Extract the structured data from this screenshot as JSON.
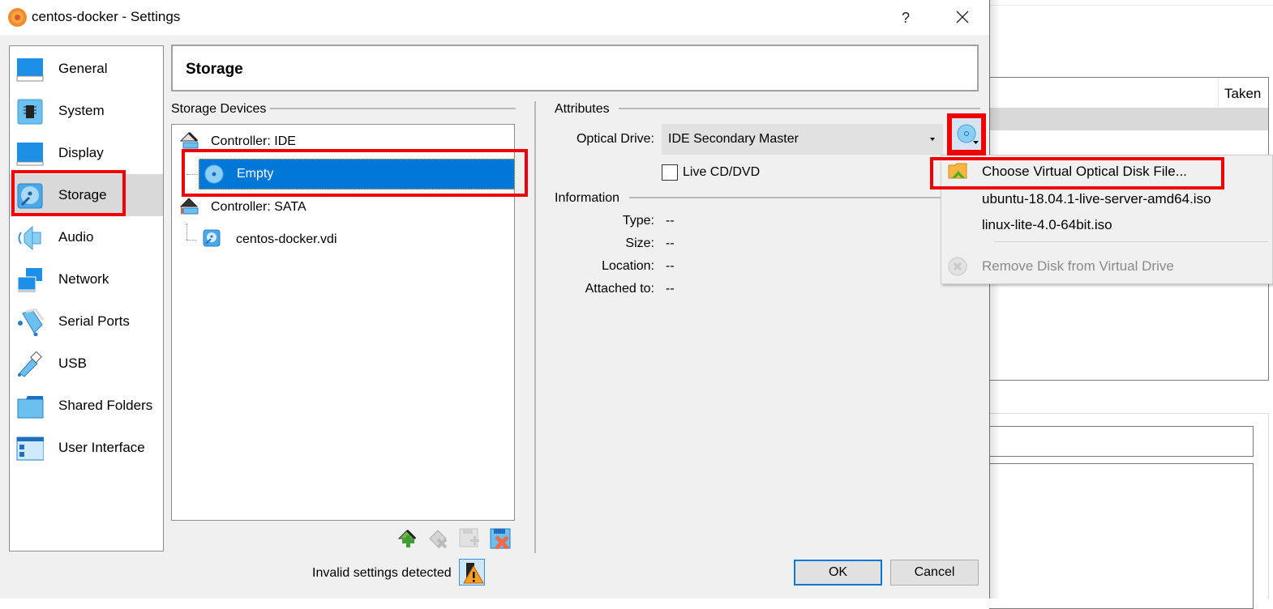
{
  "window": {
    "title": "centos-docker - Settings",
    "help_label": "?",
    "icons": {
      "app": "virtualbox-settings-icon",
      "close": "close-icon"
    }
  },
  "sidebar": {
    "items": [
      {
        "label": "General",
        "icon": "general-monitor-icon",
        "selected": false
      },
      {
        "label": "System",
        "icon": "system-chip-icon",
        "selected": false
      },
      {
        "label": "Display",
        "icon": "display-monitor-icon",
        "selected": false
      },
      {
        "label": "Storage",
        "icon": "storage-disk-icon",
        "selected": true
      },
      {
        "label": "Audio",
        "icon": "audio-speaker-icon",
        "selected": false
      },
      {
        "label": "Network",
        "icon": "network-icon",
        "selected": false
      },
      {
        "label": "Serial Ports",
        "icon": "serial-port-icon",
        "selected": false
      },
      {
        "label": "USB",
        "icon": "usb-icon",
        "selected": false
      },
      {
        "label": "Shared Folders",
        "icon": "folder-icon",
        "selected": false
      },
      {
        "label": "User Interface",
        "icon": "user-interface-icon",
        "selected": false
      }
    ]
  },
  "page": {
    "title": "Storage"
  },
  "storage_devices": {
    "group_title": "Storage Devices",
    "tree": [
      {
        "label": "Controller: IDE",
        "type": "controller",
        "icon": "ide-controller-icon"
      },
      {
        "label": "Empty",
        "type": "optical",
        "icon": "optical-disc-icon",
        "selected": true
      },
      {
        "label": "Controller: SATA",
        "type": "controller",
        "icon": "sata-controller-icon"
      },
      {
        "label": "centos-docker.vdi",
        "type": "hdd",
        "icon": "hard-disk-icon"
      }
    ],
    "toolbar": [
      {
        "name": "add-controller",
        "icon": "add-controller-icon",
        "enabled": true
      },
      {
        "name": "remove-controller",
        "icon": "remove-controller-icon",
        "enabled": false
      },
      {
        "name": "add-attachment",
        "icon": "add-attachment-icon",
        "enabled": false
      },
      {
        "name": "remove-attachment",
        "icon": "remove-attachment-icon",
        "enabled": true
      }
    ]
  },
  "attributes": {
    "group_title": "Attributes",
    "optical_drive_label": "Optical Drive:",
    "optical_drive_value": "IDE Secondary Master",
    "live_cd_label": "Live CD/DVD",
    "live_cd_checked": false
  },
  "information": {
    "group_title": "Information",
    "rows": [
      {
        "label": "Type:",
        "value": "--"
      },
      {
        "label": "Size:",
        "value": "--"
      },
      {
        "label": "Location:",
        "value": "--"
      },
      {
        "label": "Attached to:",
        "value": "--"
      }
    ]
  },
  "disk_menu": {
    "items": [
      {
        "label": "Choose Virtual Optical Disk File...",
        "icon": "folder-open-icon",
        "enabled": true
      },
      {
        "label": "ubuntu-18.04.1-live-server-amd64.iso",
        "enabled": true
      },
      {
        "label": "linux-lite-4.0-64bit.iso",
        "enabled": true
      },
      {
        "label": "Remove Disk from Virtual Drive",
        "icon": "remove-disk-icon",
        "enabled": false
      }
    ]
  },
  "footer": {
    "status": "Invalid settings detected",
    "ok_label": "OK",
    "cancel_label": "Cancel"
  },
  "background_window": {
    "column_header": "Taken"
  },
  "colors": {
    "selection": "#0078d7",
    "highlight_box": "#f00000",
    "dialog_bg": "#f0f0f0"
  }
}
